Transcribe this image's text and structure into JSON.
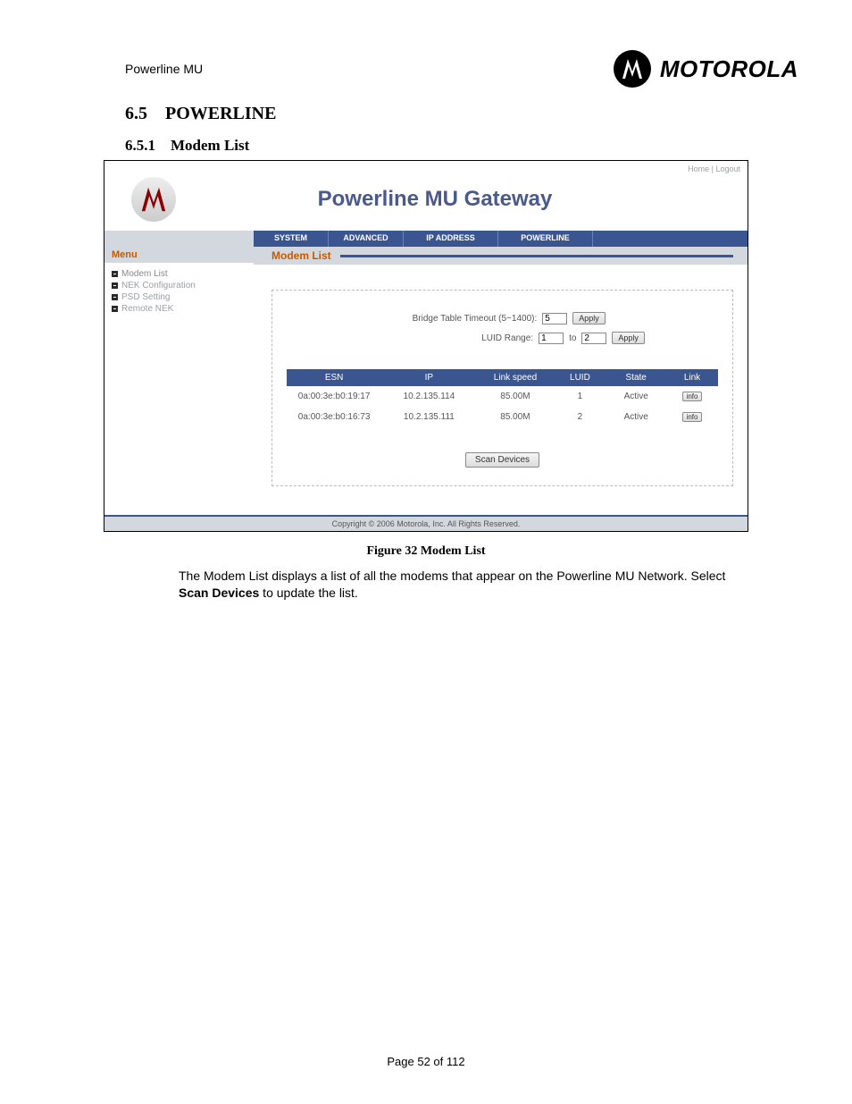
{
  "header": {
    "product": "Powerline MU",
    "brand": "MOTOROLA"
  },
  "section": {
    "number": "6.5",
    "title": "POWERLINE"
  },
  "subsection": {
    "number": "6.5.1",
    "title": "Modem List"
  },
  "screenshot": {
    "top_links": {
      "home": "Home",
      "logout": "Logout"
    },
    "app_title": "Powerline MU Gateway",
    "tabs": [
      "SYSTEM",
      "ADVANCED",
      "IP ADDRESS",
      "POWERLINE"
    ],
    "side_menu": {
      "heading": "Menu",
      "items": [
        "Modem List",
        "NEK Configuration",
        "PSD Setting",
        "Remote NEK"
      ]
    },
    "main_title": "Modem List",
    "form": {
      "bridge_label": "Bridge Table Timeout (5~1400):",
      "bridge_value": "5",
      "bridge_apply": "Apply",
      "luid_label": "LUID Range:",
      "luid_from": "1",
      "luid_to_word": "to",
      "luid_to": "2",
      "luid_apply": "Apply"
    },
    "table": {
      "headers": [
        "ESN",
        "IP",
        "Link speed",
        "LUID",
        "State",
        "Link"
      ],
      "rows": [
        {
          "esn": "0a:00:3e:b0:19:17",
          "ip": "10.2.135.114",
          "link_speed": "85.00M",
          "luid": "1",
          "state": "Active",
          "link": "info"
        },
        {
          "esn": "0a:00:3e:b0:16:73",
          "ip": "10.2.135.111",
          "link_speed": "85.00M",
          "luid": "2",
          "state": "Active",
          "link": "info"
        }
      ]
    },
    "scan_button": "Scan Devices",
    "copyright": "Copyright  ©    2006  Motorola, Inc.   All Rights Reserved."
  },
  "figure_caption": "Figure 32 Modem List",
  "body_para": {
    "pre": "The Modem List displays a list of all the modems that appear on the Powerline MU Network.  Select ",
    "bold": "Scan Devices",
    "post": " to update the list."
  },
  "page_number": "Page 52 of 112"
}
